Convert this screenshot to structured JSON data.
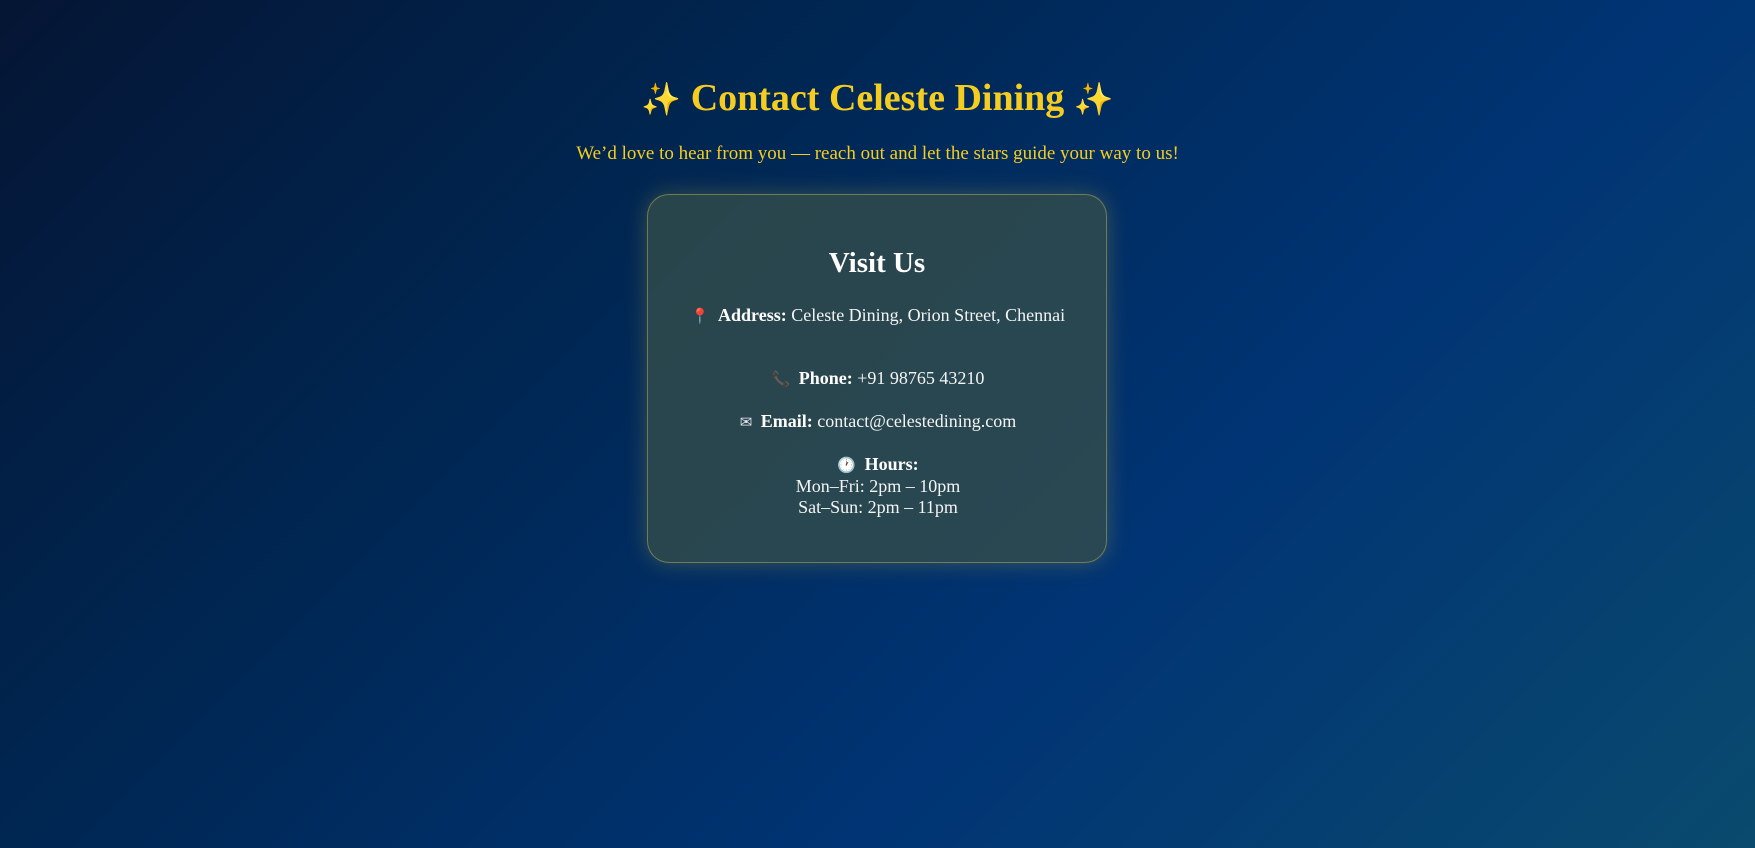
{
  "header": {
    "sparkle_left": "✨",
    "title": "Contact Celeste Dining",
    "sparkle_right": "✨",
    "subtitle": "We’d love to hear from you — reach out and let the stars guide your way to us!"
  },
  "card": {
    "title": "Visit Us",
    "address": {
      "icon": "📍",
      "label": "Address:",
      "value": "Celeste Dining, Orion Street, Chennai"
    },
    "phone": {
      "icon": "📞",
      "label": "Phone:",
      "value": "+91 98765 43210"
    },
    "email": {
      "icon": "✉",
      "label": "Email:",
      "value": "contact@celestedining.com"
    },
    "hours": {
      "icon": "🕐",
      "label": "Hours:",
      "weekdays": "Mon–Fri: 2pm – 10pm",
      "weekends": "Sat–Sun: 2pm – 11pm"
    }
  },
  "colors": {
    "accent": "#f5cd20",
    "background_start": "#051534",
    "background_end": "#0a4a6e",
    "card_background": "#344e4a"
  }
}
